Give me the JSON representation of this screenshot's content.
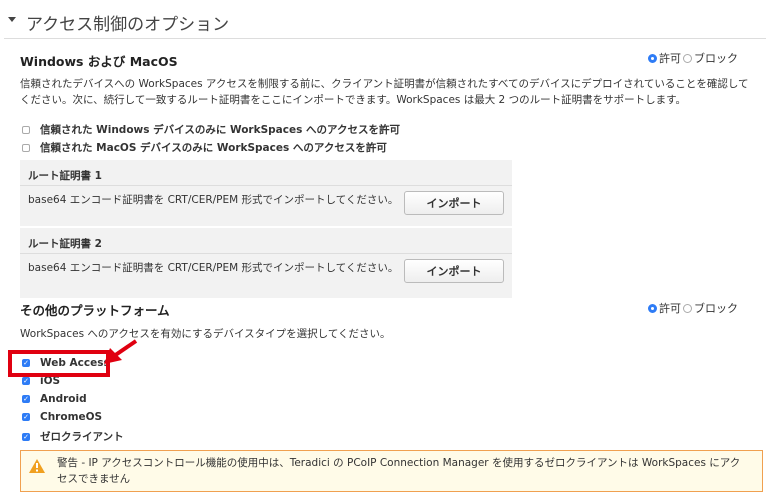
{
  "section_title": "アクセス制御のオプション",
  "windows_mac": {
    "heading": "Windows および MacOS",
    "radio_allow": "許可",
    "radio_block": "ブロック",
    "selected": "許可",
    "description": "信頼されたデバイスへの WorkSpaces アクセスを制限する前に、クライアント証明書が信頼されたすべてのデバイスにデプロイされていることを確認してください。次に、続行して一致するルート証明書をここにインポートできます。WorkSpaces は最大 2 つのルート証明書をサポートします。",
    "checkboxes": [
      {
        "label": "信頼された Windows デバイスのみに WorkSpaces へのアクセスを許可",
        "checked": false
      },
      {
        "label": "信頼された MacOS デバイスのみに WorkSpaces へのアクセスを許可",
        "checked": false
      }
    ],
    "certs": [
      {
        "title": "ルート証明書 1",
        "text": "base64 エンコード証明書を CRT/CER/PEM 形式でインポートしてください。",
        "button": "インポート"
      },
      {
        "title": "ルート証明書 2",
        "text": "base64 エンコード証明書を CRT/CER/PEM 形式でインポートしてください。",
        "button": "インポート"
      }
    ]
  },
  "other": {
    "heading": "その他のプラットフォーム",
    "radio_allow": "許可",
    "radio_block": "ブロック",
    "selected": "許可",
    "description": "WorkSpaces へのアクセスを有効にするデバイスタイプを選択してください。",
    "checkboxes": [
      {
        "label": "Web Access",
        "checked": true
      },
      {
        "label": "iOS",
        "checked": true
      },
      {
        "label": "Android",
        "checked": true
      },
      {
        "label": "ChromeOS",
        "checked": true
      },
      {
        "label": "ゼロクライアント",
        "checked": true
      }
    ]
  },
  "warning": "警告 - IP アクセスコントロール機能の使用中は、Teradici の PCoIP Connection Manager を使用するゼロクライアントは WorkSpaces にアクセスできません",
  "colors": {
    "accent": "#2e7cf6",
    "annotation": "#e00010",
    "warning_border": "#f0a050"
  }
}
